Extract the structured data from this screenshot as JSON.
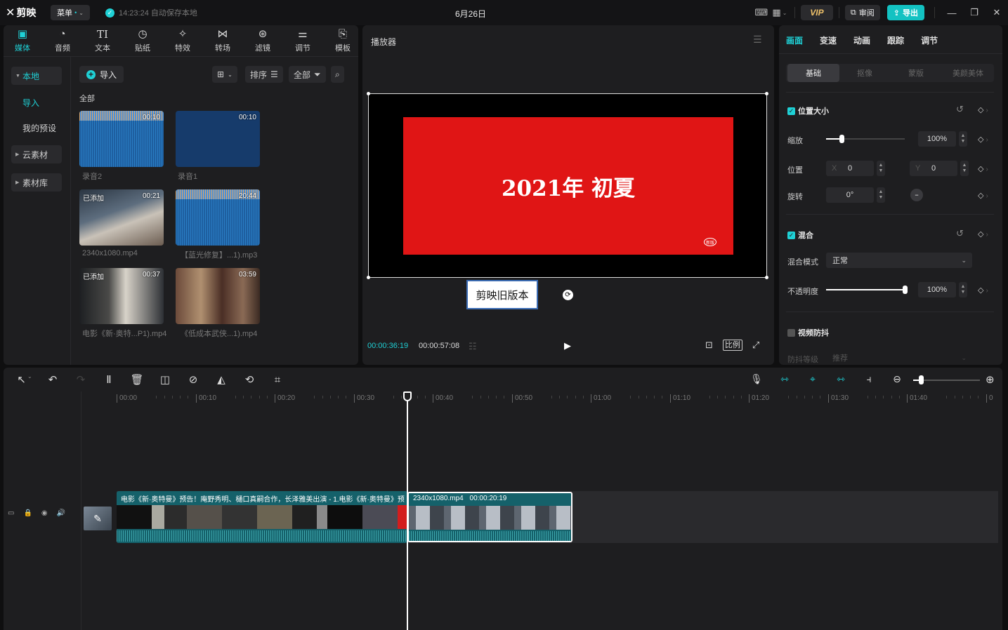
{
  "app": {
    "logo_text": "剪映",
    "menu_label": "菜单",
    "autosave_text": "14:23:24 自动保存本地",
    "project_title": "6月26日",
    "vip_label": "VIP",
    "review_label": "审阅",
    "export_label": "导出"
  },
  "media_tabs": [
    {
      "label": "媒体",
      "icon": "media-icon"
    },
    {
      "label": "音频",
      "icon": "audio-icon"
    },
    {
      "label": "文本",
      "icon": "text-icon"
    },
    {
      "label": "贴纸",
      "icon": "sticker-icon"
    },
    {
      "label": "特效",
      "icon": "effects-icon"
    },
    {
      "label": "转场",
      "icon": "transition-icon"
    },
    {
      "label": "滤镜",
      "icon": "filter-icon"
    },
    {
      "label": "调节",
      "icon": "adjust-icon"
    },
    {
      "label": "模板",
      "icon": "template-icon"
    }
  ],
  "media_sidebar": {
    "local": "本地",
    "import": "导入",
    "presets": "我的预设",
    "cloud": "云素材",
    "library": "素材库"
  },
  "media_toolbar": {
    "import_label": "导入",
    "sort_label": "排序",
    "filter_label": "全部",
    "section_label": "全部"
  },
  "media_items": [
    {
      "name": "录音2",
      "duration": "00:10",
      "added": ""
    },
    {
      "name": "录音1",
      "duration": "00:10",
      "added": ""
    },
    {
      "name": "2340x1080.mp4",
      "duration": "00:21",
      "added": "已添加"
    },
    {
      "name": "【蓝光修复】...1).mp3",
      "duration": "20:44",
      "added": ""
    },
    {
      "name": "电影《新·奥特...P1).mp4",
      "duration": "00:37",
      "added": "已添加"
    },
    {
      "name": "《低成本武侠...1).mp4",
      "duration": "03:59",
      "added": ""
    }
  ],
  "player": {
    "title": "播放器",
    "canvas_title": "2021年 初夏",
    "stamp_text": "新版",
    "old_version_label": "剪映旧版本",
    "current_time": "00:00:36:19",
    "total_time": "00:00:57:08",
    "ratio_label": "比例"
  },
  "props": {
    "tabs": [
      "画面",
      "变速",
      "动画",
      "跟踪",
      "调节"
    ],
    "subtabs": [
      "基础",
      "抠像",
      "蒙版",
      "美颜美体"
    ],
    "position_size": {
      "title": "位置大小",
      "scale_label": "缩放",
      "scale_value": "100%",
      "scale_level": 0.2,
      "position_label": "位置",
      "x_prefix": "X",
      "x_value": "0",
      "y_prefix": "Y",
      "y_value": "0",
      "rotate_label": "旋转",
      "rotate_value": "0°"
    },
    "blend": {
      "title": "混合",
      "mode_label": "混合模式",
      "mode_value": "正常",
      "opacity_label": "不透明度",
      "opacity_value": "100%",
      "opacity_level": 1.0
    },
    "stabilize": {
      "title": "视频防抖",
      "level_label": "防抖等级",
      "level_value": "推荐"
    }
  },
  "timeline": {
    "ruler_labels": [
      "00:00",
      "00:10",
      "00:20",
      "00:30",
      "00:40",
      "00:50",
      "01:00",
      "01:10",
      "01:20",
      "01:30",
      "01:40",
      "0"
    ],
    "clip1_title": "电影《新·奥特曼》预告！庵野秀明、樋口真嗣合作，长泽雅美出演 - 1.电影《新·奥特曼》预",
    "clip2_name": "2340x1080.mp4",
    "clip2_duration": "00:00:20:19"
  }
}
